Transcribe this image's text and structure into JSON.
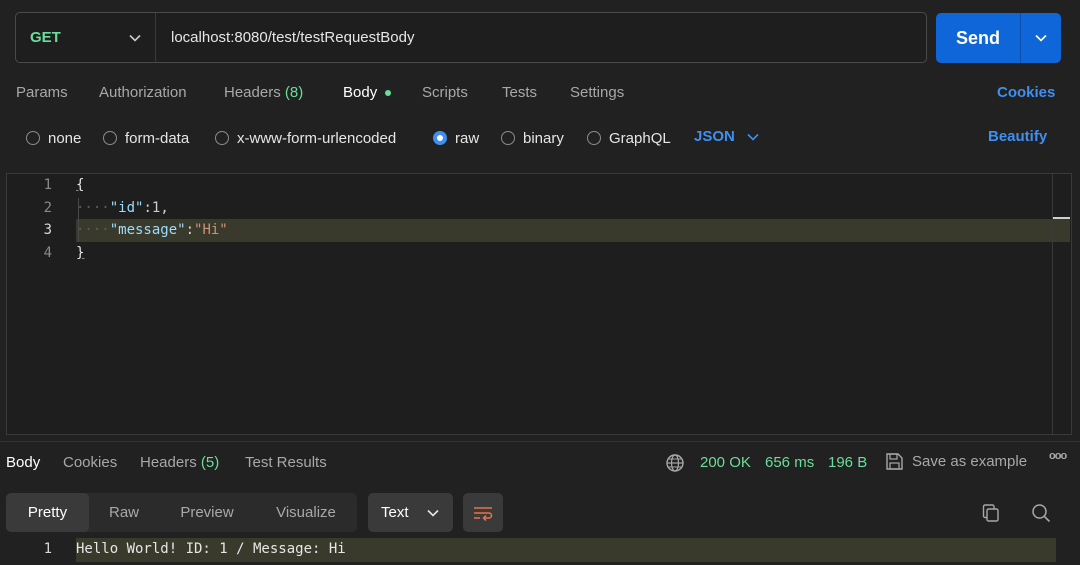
{
  "request": {
    "method": "GET",
    "url": "localhost:8080/test/testRequestBody",
    "send_label": "Send"
  },
  "request_tabs": {
    "params": "Params",
    "authorization": "Authorization",
    "headers": "Headers",
    "headers_count": "(8)",
    "body": "Body",
    "scripts": "Scripts",
    "tests": "Tests",
    "settings": "Settings",
    "cookies": "Cookies"
  },
  "body_types": {
    "none": "none",
    "form_data": "form-data",
    "urlencoded": "x-www-form-urlencoded",
    "raw": "raw",
    "binary": "binary",
    "graphql": "GraphQL",
    "selected": "raw",
    "language": "JSON",
    "beautify": "Beautify"
  },
  "editor": {
    "line_numbers": [
      "1",
      "2",
      "3",
      "4"
    ],
    "open_brace": "{",
    "close_brace": "}",
    "indent_dots": "····",
    "line2_key": "\"id\"",
    "line2_colon": ":",
    "line2_value": "1",
    "line2_comma": ",",
    "line3_key": "\"message\"",
    "line3_colon": ":",
    "line3_value": "\"Hi\""
  },
  "response_tabs": {
    "body": "Body",
    "cookies": "Cookies",
    "headers": "Headers",
    "headers_count": "(5)",
    "test_results": "Test Results"
  },
  "response_status": {
    "status": "200 OK",
    "time": "656 ms",
    "size": "196 B",
    "save_as_example": "Save as example",
    "more": "ooo"
  },
  "response_view": {
    "pretty": "Pretty",
    "raw": "Raw",
    "preview": "Preview",
    "visualize": "Visualize",
    "format": "Text"
  },
  "response_body": {
    "line_number": "1",
    "text": "Hello World! ID: 1 / Message: Hi"
  },
  "colors": {
    "accent_blue": "#0f66d9",
    "status_green": "#6bdd9a",
    "link_blue": "#3e8ff0",
    "active_dot": "#6bdd9a"
  }
}
